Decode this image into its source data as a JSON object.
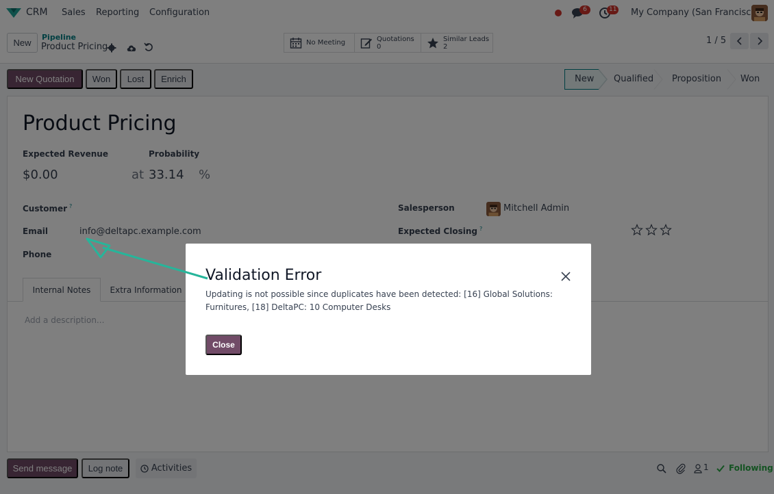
{
  "navbar": {
    "app_name": "CRM",
    "menu": [
      "Sales",
      "Reporting",
      "Configuration"
    ],
    "messages_count": "6",
    "activities_count": "11",
    "company": "My Company (San Francisco)"
  },
  "control_panel": {
    "new_label": "New",
    "breadcrumb_parent": "Pipeline",
    "breadcrumb_current": "Product Pricing",
    "smart_buttons": [
      {
        "label": "No Meeting",
        "value": ""
      },
      {
        "label": "Quotations",
        "value": "0"
      },
      {
        "label": "Similar Leads",
        "value": "2"
      }
    ],
    "pager": "1 / 5"
  },
  "statusbar": {
    "actions": [
      "New Quotation",
      "Won",
      "Lost",
      "Enrich"
    ],
    "stages": [
      "New",
      "Qualified",
      "Proposition",
      "Won"
    ],
    "active_stage": "New"
  },
  "form": {
    "title": "Product Pricing",
    "expected_revenue_label": "Expected Revenue",
    "expected_revenue": "$0.00",
    "probability_label": "Probability",
    "at_label": "at",
    "probability": "33.14",
    "percent": "%",
    "customer_label": "Customer",
    "email_label": "Email",
    "email": "info@deltapc.example.com",
    "phone_label": "Phone",
    "salesperson_label": "Salesperson",
    "salesperson": "Mitchell Admin",
    "expected_closing_label": "Expected Closing",
    "help_mark": "?",
    "tabs": [
      "Internal Notes",
      "Extra Information"
    ],
    "description_placeholder": "Add a description..."
  },
  "dialog": {
    "title": "Validation Error",
    "message": "Updating is not possible since duplicates have been detected: [16] Global Solutions: Furnitures, [18] DeltaPC: 10 Computer Desks",
    "close_label": "Close"
  },
  "chatter": {
    "send_message": "Send message",
    "log_note": "Log note",
    "activities": "Activities",
    "followers_count": "1",
    "following": "Following"
  },
  "colors": {
    "primary": "#714b67",
    "teal": "#017e84",
    "badge": "#d0342c",
    "arrow": "#26b59a"
  }
}
